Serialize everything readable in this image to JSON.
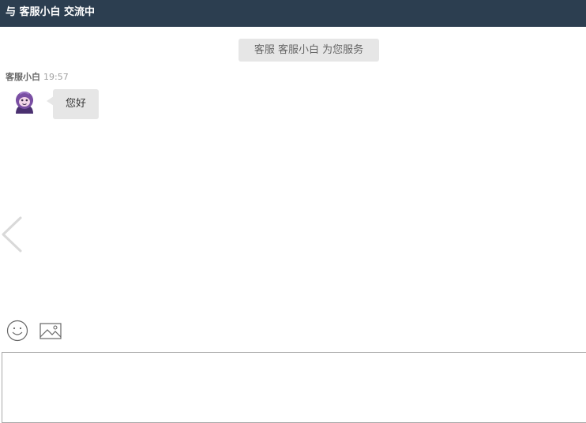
{
  "header": {
    "title": "与 客服小白 交流中"
  },
  "notice": {
    "text": "客服 客服小白 为您服务"
  },
  "messages": [
    {
      "sender": "客服小白",
      "time": "19:57",
      "text": "您好",
      "avatar_icon": "monkey-avatar-icon"
    }
  ],
  "toolbar": {
    "emoji_icon": "smiley-icon",
    "image_icon": "image-icon"
  },
  "input": {
    "value": "",
    "placeholder": ""
  },
  "nav": {
    "prev_icon": "chevron-left-icon"
  },
  "colors": {
    "header_bg": "#2c3e50",
    "bubble_bg": "#e6e6e6",
    "avatar_purple": "#7a4fa3"
  }
}
